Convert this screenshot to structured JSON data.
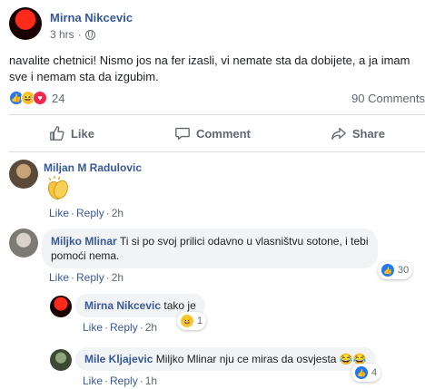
{
  "post": {
    "author": "Mirna Nikcevic",
    "time": "3 hrs",
    "privacy_icon": "globe-icon",
    "text": "navalite chetnici! Nismo jos na fer izasli, vi nemate sta da dobijete, a ja imam sve i nemam sta da izgubim.",
    "reaction_count": "24",
    "comments_count": "90 Comments"
  },
  "actions": {
    "like": "Like",
    "comment": "Comment",
    "share": "Share"
  },
  "comments": [
    {
      "author": "Miljan M Radulovic",
      "text": "",
      "sticker": "clapping-hands",
      "like": "Like",
      "reply": "Reply",
      "time": "2h",
      "reactions": ""
    },
    {
      "author": "Miljko Mlinar",
      "text": "Ti si po svoj prilici odavno u vlasništvu sotone, i tebi pomoći nema.",
      "like": "Like",
      "reply": "Reply",
      "time": "2h",
      "reactions": "30"
    },
    {
      "author": "Mirna Nikcevic",
      "text": "tako je",
      "like": "Like",
      "reply": "Reply",
      "time": "2h",
      "reactions": "1"
    },
    {
      "author": "Mile Kljajevic",
      "text": "Miljko Mlinar nju ce miras da osvjesta",
      "emoji": "😂😂",
      "like": "Like",
      "reply": "Reply",
      "time": "1h",
      "reactions": "4"
    }
  ],
  "colors": {
    "link": "#385898",
    "like_blue": "#2078f4",
    "haha_yellow": "#f7c631",
    "love_red": "#f0284a"
  }
}
